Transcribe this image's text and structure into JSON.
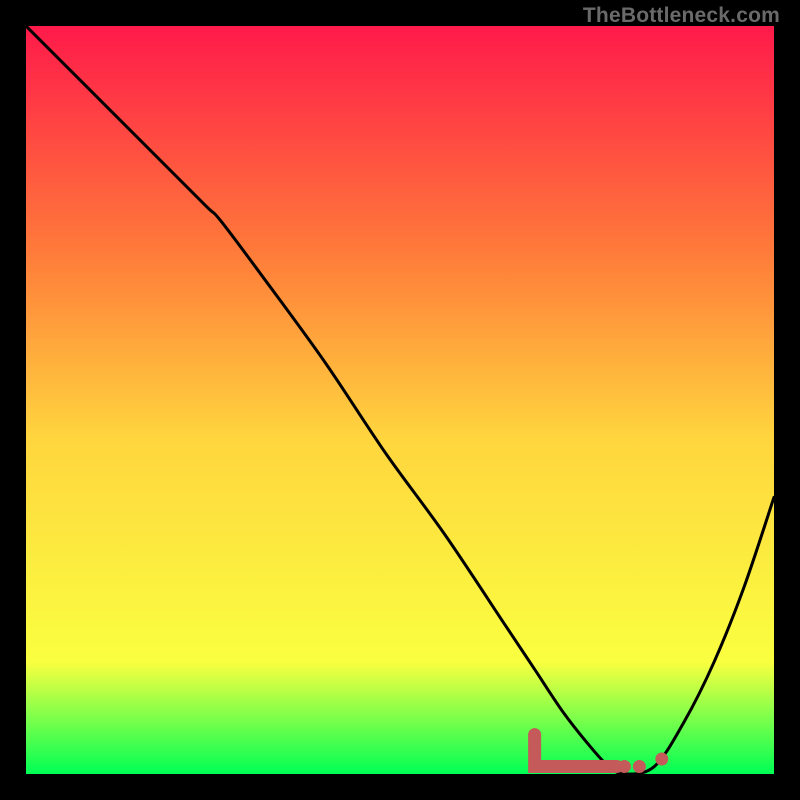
{
  "watermark": "TheBottleneck.com",
  "colors": {
    "gradient_top": "#ff1a4a",
    "gradient_q1": "#ff7a3a",
    "gradient_mid": "#ffd53e",
    "gradient_q3": "#faff40",
    "gradient_bottom": "#00ff55",
    "curve": "#000000",
    "marker_line": "#c45a5a",
    "marker_node": "#c45a5a"
  },
  "chart_data": {
    "type": "line",
    "title": "",
    "xlabel": "",
    "ylabel": "",
    "xlim": [
      0,
      100
    ],
    "ylim": [
      0,
      100
    ],
    "grid": false,
    "legend": false,
    "series": [
      {
        "name": "bottleneck-curve",
        "x": [
          0,
          8,
          16,
          24,
          26,
          32,
          40,
          48,
          56,
          64,
          68,
          72,
          76,
          78,
          80,
          84,
          88,
          92,
          96,
          100
        ],
        "y": [
          100,
          92,
          84,
          76,
          74,
          66,
          55,
          43,
          32,
          20,
          14,
          8,
          3,
          1,
          0,
          1,
          7,
          15,
          25,
          37
        ]
      }
    ],
    "markers": {
      "line_segment": {
        "x": [
          68,
          79
        ],
        "y": [
          5,
          1
        ]
      },
      "dots": [
        {
          "x": 80,
          "y": 1
        },
        {
          "x": 82,
          "y": 1
        },
        {
          "x": 85,
          "y": 2
        }
      ]
    },
    "optimum_x": 80
  }
}
